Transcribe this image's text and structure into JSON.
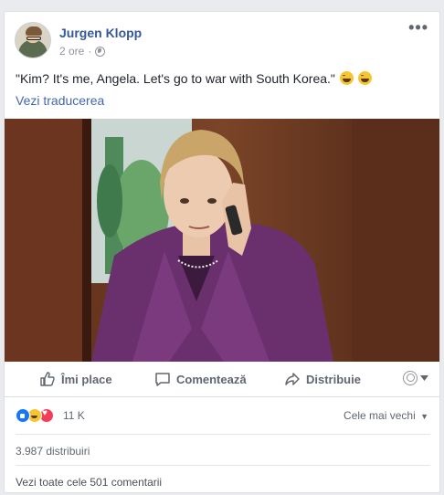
{
  "post": {
    "author": "Jurgen Klopp",
    "time": "2 ore",
    "text": "\"Kim? It's me, Angela. Let's go to war with South Korea.\"",
    "translate_link": "Vezi traducerea",
    "photo_alt": "Woman in purple blazer on phone"
  },
  "actions": {
    "like": "Îmi place",
    "comment": "Comentează",
    "share": "Distribuie"
  },
  "stats": {
    "reactions_count": "11 K",
    "sort_label": "Cele mai vechi",
    "shares": "3.987 distribuiri",
    "comments_link": "Vezi toate cele 501 comentarii"
  },
  "colors": {
    "link_blue": "#365899",
    "secondary_text": "#606770",
    "background": "#e9ebee"
  }
}
